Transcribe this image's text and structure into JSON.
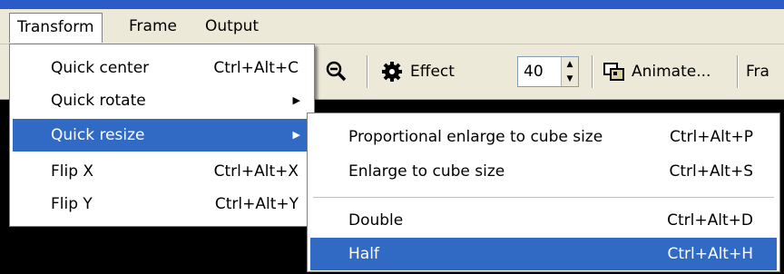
{
  "menubar": {
    "items": [
      {
        "label": "Transform"
      },
      {
        "label": "Frame"
      },
      {
        "label": "Output"
      }
    ]
  },
  "toolbar": {
    "zoom_icon": "magnifier-minus-icon",
    "effect_label": "Effect",
    "effect_icon": "gear-icon",
    "spin_value": "40",
    "animate_label": "Animate...",
    "animate_icon": "animate-frames-icon",
    "frame_label_partial": "Fra"
  },
  "transform_menu": {
    "items": [
      {
        "label": "Quick center",
        "shortcut": "Ctrl+Alt+C"
      },
      {
        "label": "Quick rotate",
        "submenu": true
      },
      {
        "label": "Quick resize",
        "submenu": true,
        "highlighted": true
      },
      {
        "label": "Flip X",
        "shortcut": "Ctrl+Alt+X"
      },
      {
        "label": "Flip Y",
        "shortcut": "Ctrl+Alt+Y"
      }
    ]
  },
  "resize_submenu": {
    "items": [
      {
        "label": "Proportional enlarge to cube size",
        "shortcut": "Ctrl+Alt+P"
      },
      {
        "label": "Enlarge to cube size",
        "shortcut": "Ctrl+Alt+S"
      },
      {
        "label": "Double",
        "shortcut": "Ctrl+Alt+D"
      },
      {
        "label": "Half",
        "shortcut": "Ctrl+Alt+H",
        "highlighted": true
      }
    ]
  },
  "colors": {
    "highlight": "#316ac5",
    "menu_bg": "#ffffff",
    "chrome": "#ece9d8"
  }
}
